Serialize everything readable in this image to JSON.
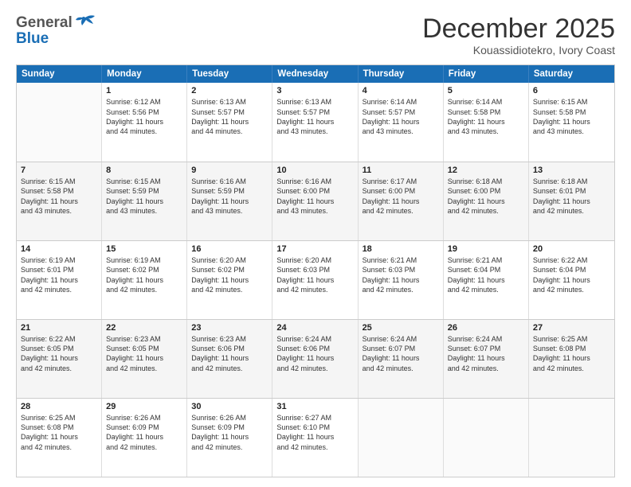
{
  "header": {
    "logo_general": "General",
    "logo_blue": "Blue",
    "month_title": "December 2025",
    "subtitle": "Kouassidiotekro, Ivory Coast"
  },
  "calendar": {
    "days": [
      "Sunday",
      "Monday",
      "Tuesday",
      "Wednesday",
      "Thursday",
      "Friday",
      "Saturday"
    ],
    "weeks": [
      [
        {
          "day": "",
          "info": ""
        },
        {
          "day": "1",
          "info": "Sunrise: 6:12 AM\nSunset: 5:56 PM\nDaylight: 11 hours\nand 44 minutes."
        },
        {
          "day": "2",
          "info": "Sunrise: 6:13 AM\nSunset: 5:57 PM\nDaylight: 11 hours\nand 44 minutes."
        },
        {
          "day": "3",
          "info": "Sunrise: 6:13 AM\nSunset: 5:57 PM\nDaylight: 11 hours\nand 43 minutes."
        },
        {
          "day": "4",
          "info": "Sunrise: 6:14 AM\nSunset: 5:57 PM\nDaylight: 11 hours\nand 43 minutes."
        },
        {
          "day": "5",
          "info": "Sunrise: 6:14 AM\nSunset: 5:58 PM\nDaylight: 11 hours\nand 43 minutes."
        },
        {
          "day": "6",
          "info": "Sunrise: 6:15 AM\nSunset: 5:58 PM\nDaylight: 11 hours\nand 43 minutes."
        }
      ],
      [
        {
          "day": "7",
          "info": "Sunrise: 6:15 AM\nSunset: 5:58 PM\nDaylight: 11 hours\nand 43 minutes."
        },
        {
          "day": "8",
          "info": "Sunrise: 6:15 AM\nSunset: 5:59 PM\nDaylight: 11 hours\nand 43 minutes."
        },
        {
          "day": "9",
          "info": "Sunrise: 6:16 AM\nSunset: 5:59 PM\nDaylight: 11 hours\nand 43 minutes."
        },
        {
          "day": "10",
          "info": "Sunrise: 6:16 AM\nSunset: 6:00 PM\nDaylight: 11 hours\nand 43 minutes."
        },
        {
          "day": "11",
          "info": "Sunrise: 6:17 AM\nSunset: 6:00 PM\nDaylight: 11 hours\nand 42 minutes."
        },
        {
          "day": "12",
          "info": "Sunrise: 6:18 AM\nSunset: 6:00 PM\nDaylight: 11 hours\nand 42 minutes."
        },
        {
          "day": "13",
          "info": "Sunrise: 6:18 AM\nSunset: 6:01 PM\nDaylight: 11 hours\nand 42 minutes."
        }
      ],
      [
        {
          "day": "14",
          "info": "Sunrise: 6:19 AM\nSunset: 6:01 PM\nDaylight: 11 hours\nand 42 minutes."
        },
        {
          "day": "15",
          "info": "Sunrise: 6:19 AM\nSunset: 6:02 PM\nDaylight: 11 hours\nand 42 minutes."
        },
        {
          "day": "16",
          "info": "Sunrise: 6:20 AM\nSunset: 6:02 PM\nDaylight: 11 hours\nand 42 minutes."
        },
        {
          "day": "17",
          "info": "Sunrise: 6:20 AM\nSunset: 6:03 PM\nDaylight: 11 hours\nand 42 minutes."
        },
        {
          "day": "18",
          "info": "Sunrise: 6:21 AM\nSunset: 6:03 PM\nDaylight: 11 hours\nand 42 minutes."
        },
        {
          "day": "19",
          "info": "Sunrise: 6:21 AM\nSunset: 6:04 PM\nDaylight: 11 hours\nand 42 minutes."
        },
        {
          "day": "20",
          "info": "Sunrise: 6:22 AM\nSunset: 6:04 PM\nDaylight: 11 hours\nand 42 minutes."
        }
      ],
      [
        {
          "day": "21",
          "info": "Sunrise: 6:22 AM\nSunset: 6:05 PM\nDaylight: 11 hours\nand 42 minutes."
        },
        {
          "day": "22",
          "info": "Sunrise: 6:23 AM\nSunset: 6:05 PM\nDaylight: 11 hours\nand 42 minutes."
        },
        {
          "day": "23",
          "info": "Sunrise: 6:23 AM\nSunset: 6:06 PM\nDaylight: 11 hours\nand 42 minutes."
        },
        {
          "day": "24",
          "info": "Sunrise: 6:24 AM\nSunset: 6:06 PM\nDaylight: 11 hours\nand 42 minutes."
        },
        {
          "day": "25",
          "info": "Sunrise: 6:24 AM\nSunset: 6:07 PM\nDaylight: 11 hours\nand 42 minutes."
        },
        {
          "day": "26",
          "info": "Sunrise: 6:24 AM\nSunset: 6:07 PM\nDaylight: 11 hours\nand 42 minutes."
        },
        {
          "day": "27",
          "info": "Sunrise: 6:25 AM\nSunset: 6:08 PM\nDaylight: 11 hours\nand 42 minutes."
        }
      ],
      [
        {
          "day": "28",
          "info": "Sunrise: 6:25 AM\nSunset: 6:08 PM\nDaylight: 11 hours\nand 42 minutes."
        },
        {
          "day": "29",
          "info": "Sunrise: 6:26 AM\nSunset: 6:09 PM\nDaylight: 11 hours\nand 42 minutes."
        },
        {
          "day": "30",
          "info": "Sunrise: 6:26 AM\nSunset: 6:09 PM\nDaylight: 11 hours\nand 42 minutes."
        },
        {
          "day": "31",
          "info": "Sunrise: 6:27 AM\nSunset: 6:10 PM\nDaylight: 11 hours\nand 42 minutes."
        },
        {
          "day": "",
          "info": ""
        },
        {
          "day": "",
          "info": ""
        },
        {
          "day": "",
          "info": ""
        }
      ]
    ]
  }
}
